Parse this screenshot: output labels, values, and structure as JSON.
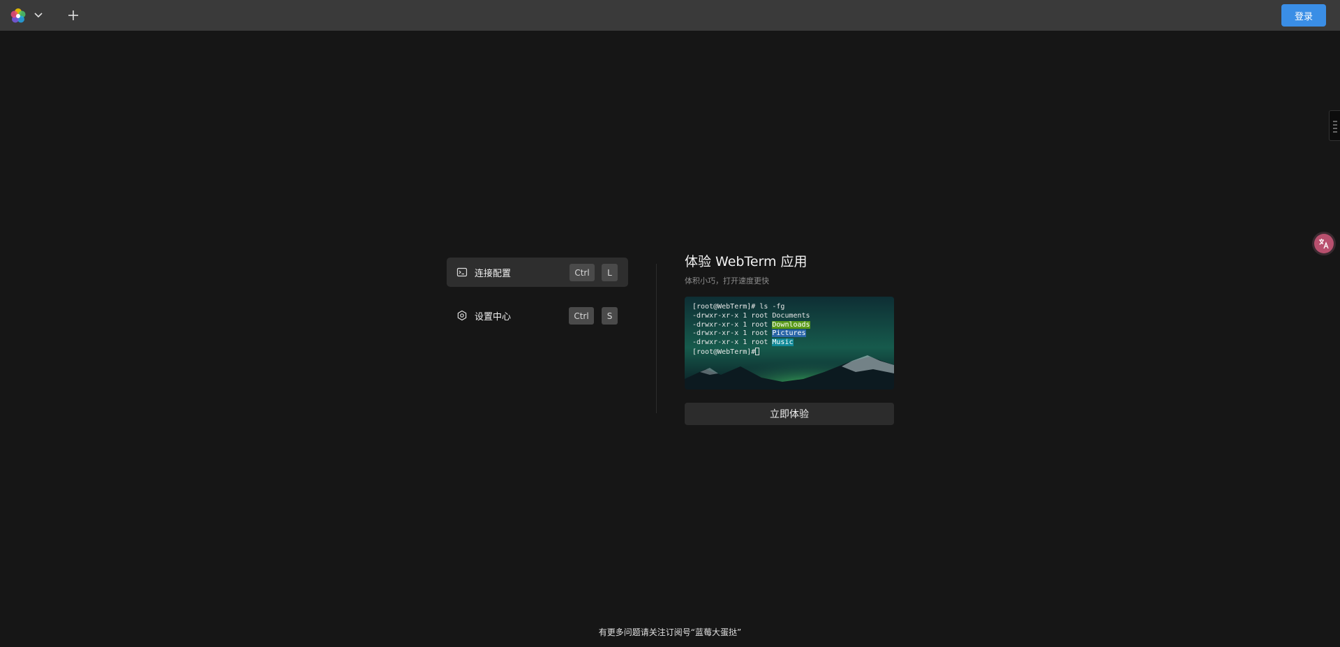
{
  "topbar": {
    "logo_icon": "pinwheel-logo-icon",
    "dropdown_icon": "chevron-down-icon",
    "new_tab_icon": "plus-icon",
    "login_label": "登录",
    "accent_color": "#3a8ee6"
  },
  "menu": {
    "items": [
      {
        "icon": "terminal-icon",
        "label": "连接配置",
        "keys": [
          "Ctrl",
          "L"
        ],
        "active": true
      },
      {
        "icon": "settings-icon",
        "label": "设置中心",
        "keys": [
          "Ctrl",
          "S"
        ],
        "active": false
      }
    ]
  },
  "promo": {
    "title": "体验 WebTerm 应用",
    "subtitle": "体积小巧，打开速度更快",
    "terminal": {
      "line1": "[root@WebTerm]# ls -fg",
      "line2_prefix": "-drwxr-xr-x 1 root ",
      "line2_name": "Documents",
      "line3_prefix": "-drwxr-xr-x 1 root ",
      "line3_name": "Downloads",
      "line4_prefix": "-drwxr-xr-x 1 root ",
      "line4_name": "Pictures",
      "line5_prefix": "-drwxr-xr-x 1 root ",
      "line5_name": "Music",
      "line6": "[root@WebTerm]#"
    },
    "button_label": "立即体验"
  },
  "side": {
    "translate_icon": "translate-icon",
    "handle_icon": "drag-handle-icon"
  },
  "footer": {
    "text": "有更多问题请关注订阅号“蓝莓大蛋挞”"
  }
}
